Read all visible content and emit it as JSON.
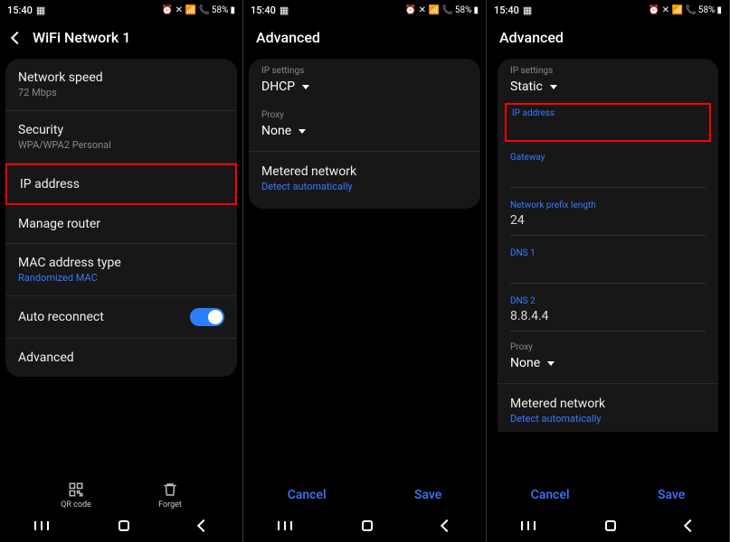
{
  "statusbar": {
    "time": "15:40",
    "battery": "58%",
    "icons_right": "⏰ ✈ 📶 📞"
  },
  "screen1": {
    "title": "WiFi Network 1",
    "rows": {
      "network_speed": {
        "title": "Network speed",
        "sub": "72 Mbps"
      },
      "security": {
        "title": "Security",
        "sub": "WPA/WPA2 Personal"
      },
      "ip_address": {
        "title": "IP address"
      },
      "manage_router": {
        "title": "Manage router"
      },
      "mac": {
        "title": "MAC address type",
        "sub": "Randomized MAC"
      },
      "auto_reconnect": {
        "title": "Auto reconnect"
      },
      "advanced": {
        "title": "Advanced"
      }
    },
    "bottom": {
      "qr": "QR code",
      "forget": "Forget"
    }
  },
  "screen2": {
    "title": "Advanced",
    "ip_settings_label": "IP settings",
    "ip_settings_value": "DHCP",
    "proxy_label": "Proxy",
    "proxy_value": "None",
    "metered_title": "Metered network",
    "metered_sub": "Detect automatically",
    "cancel": "Cancel",
    "save": "Save"
  },
  "screen3": {
    "title": "Advanced",
    "ip_settings_label": "IP settings",
    "ip_settings_value": "Static",
    "ip_address_label": "IP address",
    "ip_address_value": "",
    "gateway_label": "Gateway",
    "gateway_value": "",
    "prefix_label": "Network prefix length",
    "prefix_value": "24",
    "dns1_label": "DNS 1",
    "dns1_value": "",
    "dns2_label": "DNS 2",
    "dns2_value": "8.8.4.4",
    "proxy_label": "Proxy",
    "proxy_value": "None",
    "metered_title": "Metered network",
    "metered_sub": "Detect automatically",
    "cancel": "Cancel",
    "save": "Save"
  }
}
